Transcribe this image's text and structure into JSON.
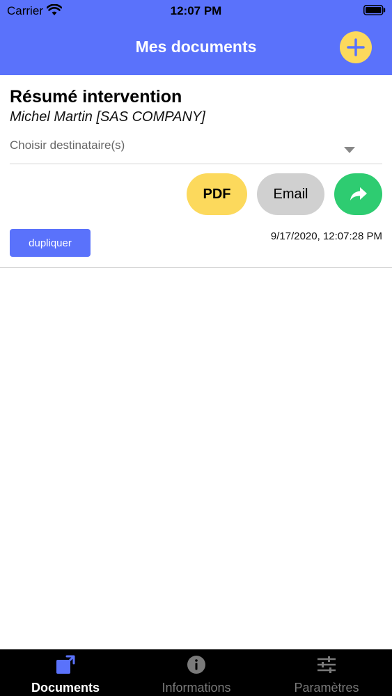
{
  "status_bar": {
    "carrier": "Carrier",
    "time": "12:07 PM"
  },
  "header": {
    "title": "Mes documents",
    "add_icon": "plus-icon"
  },
  "document": {
    "title": "Résumé intervention",
    "subtitle": "Michel Martin [SAS COMPANY]",
    "recipient_placeholder": "Choisir destinataire(s)",
    "pdf_label": "PDF",
    "email_label": "Email",
    "share_icon": "share-arrow-icon",
    "duplicate_label": "dupliquer",
    "date": "9/17/2020, 12:07:28 PM"
  },
  "tabs": [
    {
      "label": "Documents",
      "icon": "external-link-icon",
      "active": true
    },
    {
      "label": "Informations",
      "icon": "info-icon",
      "active": false
    },
    {
      "label": "Paramètres",
      "icon": "sliders-icon",
      "active": false
    }
  ],
  "colors": {
    "primary": "#5a72fb",
    "accent_yellow": "#fcd95c",
    "share_green": "#2ecc71",
    "email_grey": "#d0d0d0",
    "tab_bar": "#000000"
  }
}
